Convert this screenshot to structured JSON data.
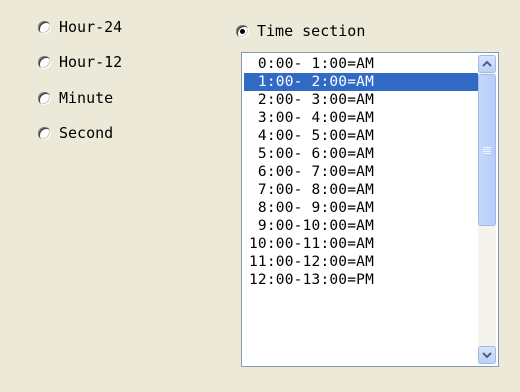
{
  "radios": {
    "hour24": {
      "label": "Hour-24",
      "checked": false
    },
    "hour12": {
      "label": "Hour-12",
      "checked": false
    },
    "minute": {
      "label": "Minute",
      "checked": false
    },
    "second": {
      "label": "Second",
      "checked": false
    },
    "time_section": {
      "label": "Time section",
      "checked": true
    }
  },
  "list": {
    "items": [
      " 0:00- 1:00=AM",
      " 1:00- 2:00=AM",
      " 2:00- 3:00=AM",
      " 3:00- 4:00=AM",
      " 4:00- 5:00=AM",
      " 5:00- 6:00=AM",
      " 6:00- 7:00=AM",
      " 7:00- 8:00=AM",
      " 8:00- 9:00=AM",
      " 9:00-10:00=AM",
      "10:00-11:00=AM",
      "11:00-12:00=AM",
      "12:00-13:00=PM"
    ],
    "selected_index": 1
  },
  "icons": {
    "scroll_up": "chevron-up-icon",
    "scroll_down": "chevron-down-icon",
    "thumb_grip": "grip-icon"
  },
  "colors": {
    "background": "#ece9d8",
    "selection": "#316ac5",
    "list_border": "#7f9db9"
  }
}
